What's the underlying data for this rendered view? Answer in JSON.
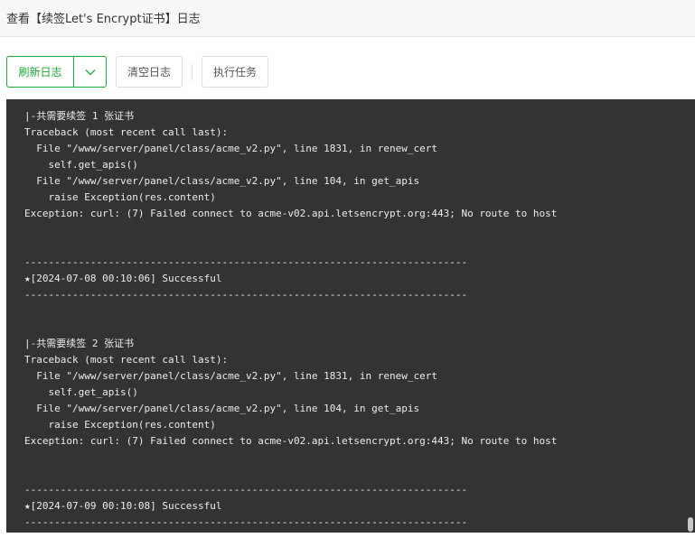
{
  "window": {
    "title": "查看【续签Let's Encrypt证书】日志"
  },
  "toolbar": {
    "refresh_label": "刷新日志",
    "dropdown_icon": "chevron-down-icon",
    "clear_label": "清空日志",
    "run_label": "执行任务"
  },
  "colors": {
    "accent": "#20a53a",
    "log_background": "#333333",
    "log_text": "#ececec"
  },
  "log": {
    "lines": [
      "|-共需要续签 1 张证书",
      "Traceback (most recent call last):",
      "  File \"/www/server/panel/class/acme_v2.py\", line 1831, in renew_cert",
      "    self.get_apis()",
      "  File \"/www/server/panel/class/acme_v2.py\", line 104, in get_apis",
      "    raise Exception(res.content)",
      "Exception: curl: (7) Failed connect to acme-v02.api.letsencrypt.org:443; No route to host",
      "",
      "",
      "--------------------------------------------------------------------------",
      "★[2024-07-08 00:10:06] Successful",
      "--------------------------------------------------------------------------",
      "",
      "",
      "|-共需要续签 2 张证书",
      "Traceback (most recent call last):",
      "  File \"/www/server/panel/class/acme_v2.py\", line 1831, in renew_cert",
      "    self.get_apis()",
      "  File \"/www/server/panel/class/acme_v2.py\", line 104, in get_apis",
      "    raise Exception(res.content)",
      "Exception: curl: (7) Failed connect to acme-v02.api.letsencrypt.org:443; No route to host",
      "",
      "",
      "--------------------------------------------------------------------------",
      "★[2024-07-09 00:10:08] Successful",
      "--------------------------------------------------------------------------"
    ]
  }
}
